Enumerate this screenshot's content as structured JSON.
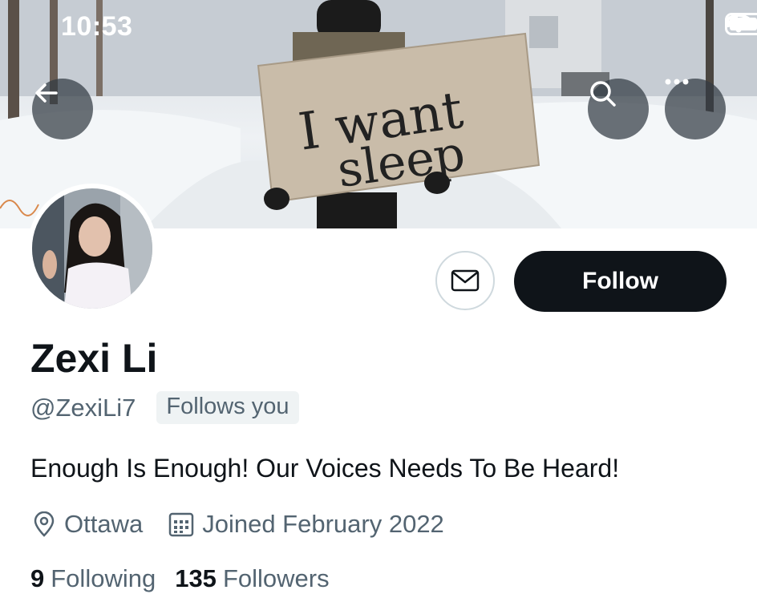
{
  "status_bar": {
    "time": "10:53"
  },
  "banner": {
    "sign_text_line1": "I want",
    "sign_text_line2": "sleep"
  },
  "profile": {
    "display_name": "Zexi Li",
    "handle": "@ZexiLi7",
    "follows_you_badge": "Follows you",
    "bio": "Enough Is Enough! Our Voices Needs To Be Heard!",
    "location": "Ottawa",
    "joined": "Joined February 2022",
    "following_count": "9",
    "following_label": "Following",
    "followers_count": "135",
    "followers_label": "Followers"
  },
  "actions": {
    "follow_label": "Follow"
  },
  "icons": {
    "back": "arrow-left-icon",
    "search": "search-icon",
    "more": "more-horizontal-icon",
    "message": "envelope-icon",
    "location": "location-pin-icon",
    "calendar": "calendar-icon"
  },
  "colors": {
    "primary_text": "#0f1419",
    "secondary_text": "#536471",
    "follow_bg": "#0f1419",
    "badge_bg": "#eff3f4"
  }
}
